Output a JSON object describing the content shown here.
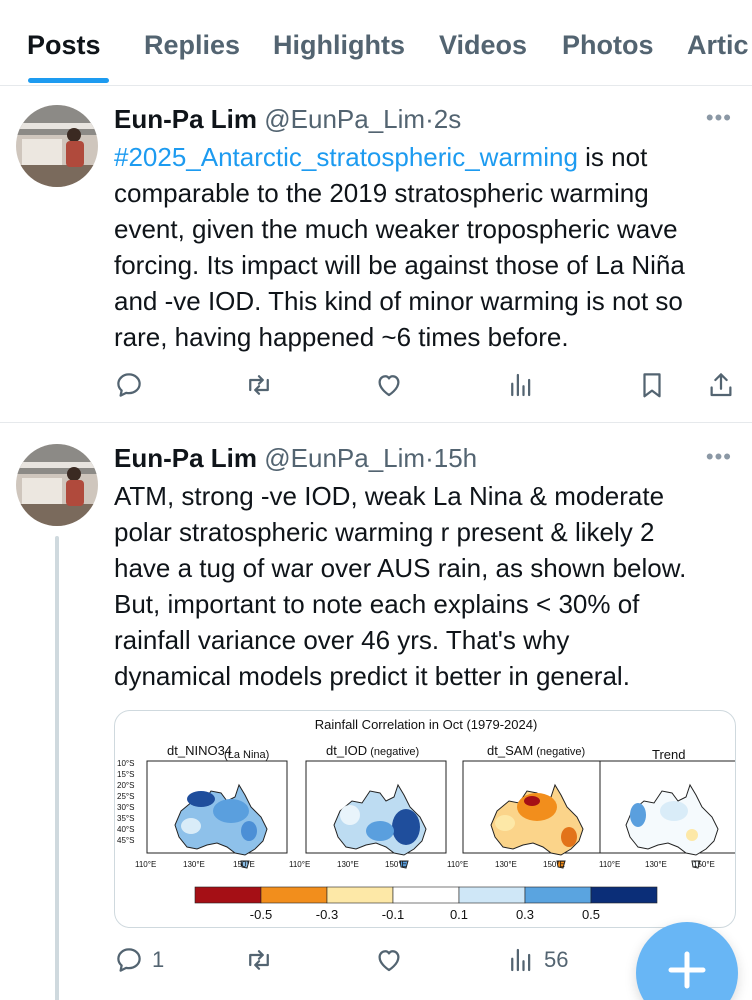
{
  "tabs": [
    {
      "label": "Posts"
    },
    {
      "label": "Replies"
    },
    {
      "label": "Highlights"
    },
    {
      "label": "Videos"
    },
    {
      "label": "Photos"
    },
    {
      "label": "Artic"
    }
  ],
  "posts": [
    {
      "name": "Eun-Pa Lim",
      "handle": "@EunPa_Lim",
      "time": "2s",
      "hashtag": "#2025_Antarctic_stratospheric_warming",
      "text_lines": [
        " is not",
        "comparable to the 2019 stratospheric warming",
        "event, given the much weaker tropospheric wave",
        "forcing. Its impact will be against those of La Niña",
        "and -ve IOD. This kind of minor warming is not so",
        "rare, having happened ~6 times before."
      ],
      "actions": {
        "reply": "",
        "repost": "",
        "like": "",
        "views": ""
      }
    },
    {
      "name": "Eun-Pa Lim",
      "handle": "@EunPa_Lim",
      "time": "15h",
      "text_lines": [
        "ATM, strong -ve IOD, weak La Nina & moderate",
        "polar stratospheric warming r present & likely 2",
        "have a tug of war over AUS rain, as shown below.",
        "But, important to note each explains < 30% of",
        "rainfall variance over 46 yrs. That's why",
        "dynamical models predict it better in general."
      ],
      "actions": {
        "reply": "1",
        "repost": "",
        "like": "",
        "views": "56"
      }
    }
  ],
  "figure": {
    "title": "Rainfall Correlation in Oct (1979-2024)",
    "panels": [
      {
        "name": "dt_NINO34",
        "note": "(La Nina)"
      },
      {
        "name": "dt_IOD",
        "note": "(negative)"
      },
      {
        "name": "dt_SAM",
        "note": "(negative)"
      },
      {
        "name": "Trend",
        "note": ""
      }
    ],
    "lat_ticks": [
      "10°S",
      "15°S",
      "20°S",
      "25°S",
      "30°S",
      "35°S",
      "40°S",
      "45°S"
    ],
    "lon_ticks": [
      "110°E",
      "130°E",
      "150°E"
    ],
    "colorbar_labels": [
      "-0.5",
      "-0.3",
      "-0.1",
      "0.1",
      "0.3",
      "0.5"
    ],
    "colorbar_colors": [
      "#a50f15",
      "#f28e1c",
      "#fde8a7",
      "#ffffff",
      "#cfe7f7",
      "#5aa4e0",
      "#0b2e78"
    ]
  },
  "colors": {
    "accent": "#1d9bf0",
    "text": "#0f1419",
    "muted": "#536471",
    "fab": "#68b6f5"
  },
  "icons": [
    "reply-icon",
    "repost-icon",
    "like-icon",
    "views-icon",
    "bookmark-icon",
    "share-icon",
    "more-icon",
    "compose-icon"
  ]
}
